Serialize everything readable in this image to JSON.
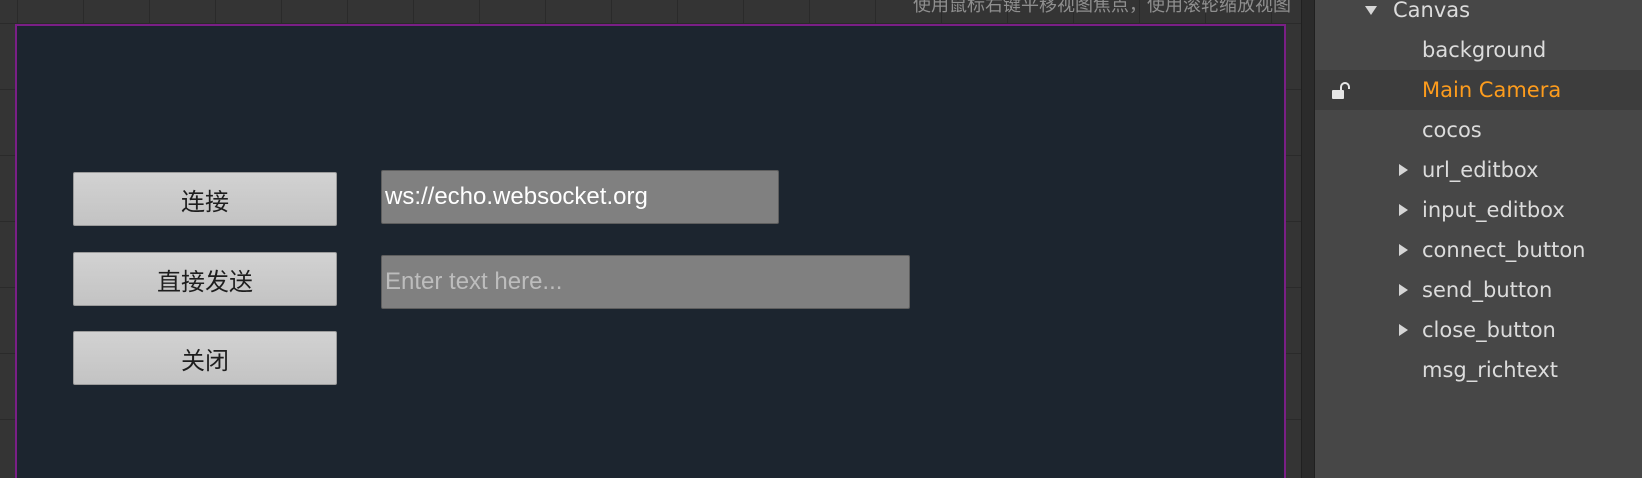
{
  "scene": {
    "hint": "使用鼠标右键平移视图焦点，使用滚轮缩放视图",
    "buttons": {
      "connect": "连接",
      "send": "直接发送",
      "close": "关闭"
    },
    "url_editbox": {
      "value": "ws://echo.websocket.org"
    },
    "input_editbox": {
      "placeholder": "Enter text here..."
    }
  },
  "hierarchy": {
    "root": "Canvas",
    "selected": "Main Camera",
    "nodes": [
      {
        "label": "background",
        "expandable": false
      },
      {
        "label": "Main Camera",
        "expandable": false
      },
      {
        "label": "cocos",
        "expandable": false
      },
      {
        "label": "url_editbox",
        "expandable": true
      },
      {
        "label": "input_editbox",
        "expandable": true
      },
      {
        "label": "connect_button",
        "expandable": true
      },
      {
        "label": "send_button",
        "expandable": true
      },
      {
        "label": "close_button",
        "expandable": true
      },
      {
        "label": "msg_richtext",
        "expandable": false
      }
    ]
  },
  "colors": {
    "canvas_bg": "#1c252f",
    "canvas_border": "#7a1f86",
    "selected_text": "#fd9c1d",
    "panel_bg": "#474747"
  }
}
